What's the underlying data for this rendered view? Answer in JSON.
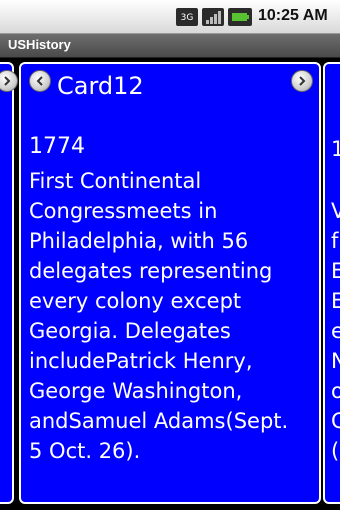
{
  "status_bar": {
    "time": "10:25 AM",
    "icons": [
      "3g-icon",
      "signal-icon",
      "battery-icon"
    ]
  },
  "app": {
    "title": "USHistory"
  },
  "card": {
    "title": "Card12",
    "year": "1774",
    "body": " First Continental\nCongressmeets in\nPhiladelphia, with 56\ndelegates representing\nevery colony except\nGeorgia. Delegates\nincludePatrick Henry,\nGeorge Washington,\nandSamuel Adams(Sept.\n5 Oct. 26).",
    "nav": {
      "prev_icon": "chevron-left-icon",
      "next_icon": "chevron-right-icon"
    }
  },
  "next_card_fragment": {
    "chars": [
      "1",
      "V",
      "f",
      "E",
      "E",
      "e",
      "N",
      "o",
      "C",
      "("
    ]
  },
  "colors": {
    "card_bg": "#0000ff",
    "card_border": "#ffffff",
    "title_bar": "#555555",
    "status_bar": "#e6e6e6"
  }
}
